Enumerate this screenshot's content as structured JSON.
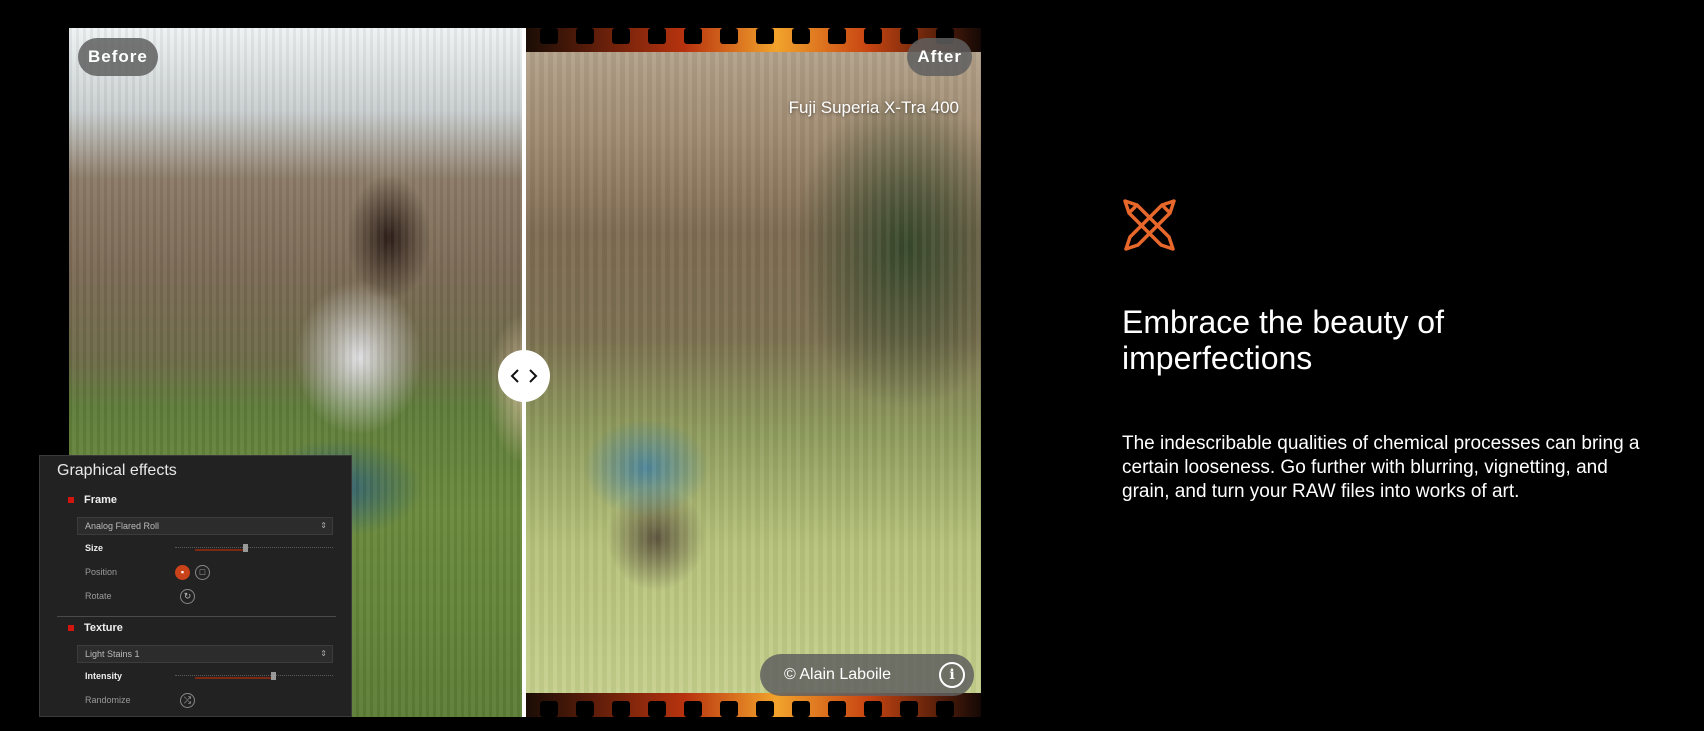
{
  "viewer": {
    "before_label": "Before",
    "after_label": "After",
    "film_name": "Fuji Superia X-Tra 400",
    "credit": "© Alain Laboile",
    "divider_position": 0.5
  },
  "panel": {
    "title": "Graphical effects",
    "frame": {
      "heading": "Frame",
      "preset": "Analog Flared Roll",
      "size_label": "Size",
      "size_value": 0.44,
      "position_label": "Position",
      "rotate_label": "Rotate"
    },
    "texture": {
      "heading": "Texture",
      "preset": "Light Stains 1",
      "intensity_label": "Intensity",
      "intensity_value": 0.62,
      "randomize_label": "Randomize"
    }
  },
  "feature": {
    "icon": "crossed-brushes-icon",
    "accent_color": "#e8672a",
    "headline": "Embrace the beauty of imperfections",
    "body": "The indescribable qualities of chemical processes can bring a certain looseness. Go further with blurring, vignetting, and grain, and turn your RAW files into works of art."
  }
}
